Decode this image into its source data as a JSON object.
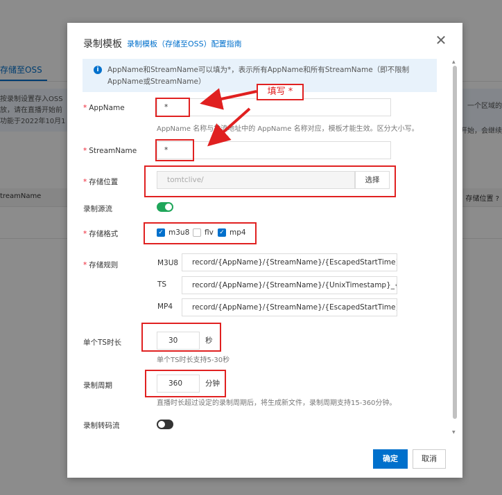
{
  "background": {
    "tab_label": "存储至OSS",
    "notice_left": "按录制设置存入OSS\n放，请在直播开始前\n功能于2022年10月1",
    "notice_right": "一个区域的\n开始，会继续",
    "table_col_left": "treamName",
    "table_col_right": "存储位置 ?"
  },
  "modal": {
    "title": "录制模板",
    "guide_link": "录制模板（存储至OSS）配置指南",
    "close_icon": "close-icon",
    "info_text": "AppName和StreamName可以填为*，表示所有AppName和所有StreamName（即不限制AppName或StreamName）",
    "fields": {
      "app_name": {
        "label": "AppName",
        "value": "*",
        "hint": "AppName 名称与推流地址中的 AppName 名称对应，模板才能生效。区分大小写。"
      },
      "stream_name": {
        "label": "StreamName",
        "value": "*"
      },
      "storage_location": {
        "label": "存储位置",
        "value": "tomtclive/",
        "button": "选择"
      },
      "record_source": {
        "label": "录制源流",
        "enabled": true
      },
      "storage_format": {
        "label": "存储格式",
        "options": [
          {
            "name": "m3u8",
            "checked": true
          },
          {
            "name": "flv",
            "checked": false
          },
          {
            "name": "mp4",
            "checked": true
          }
        ]
      },
      "storage_rule": {
        "label": "存储规则",
        "rows": [
          {
            "name": "M3U8",
            "value": "record/{AppName}/{StreamName}/{EscapedStartTime}_{Esca"
          },
          {
            "name": "TS",
            "value": "record/{AppName}/{StreamName}/{UnixTimestamp}_{Seque"
          },
          {
            "name": "MP4",
            "value": "record/{AppName}/{StreamName}/{EscapedStartTime}_{Esca"
          }
        ]
      },
      "ts_duration": {
        "label": "单个TS时长",
        "value": "30",
        "unit": "秒",
        "hint": "单个TS时长支持5-30秒"
      },
      "record_period": {
        "label": "录制周期",
        "value": "360",
        "unit": "分钟",
        "hint": "直播时长超过设定的录制周期后，将生成新文件，录制周期支持15-360分钟。"
      },
      "transcode_record": {
        "label": "录制转码流",
        "enabled": false
      }
    },
    "buttons": {
      "ok": "确定",
      "cancel": "取消"
    }
  },
  "annotation": {
    "callout_text": "填写 *",
    "color": "#e02020"
  },
  "colors": {
    "primary": "#0070cc",
    "toggle_on": "#1fa65a",
    "required": "#e23"
  }
}
